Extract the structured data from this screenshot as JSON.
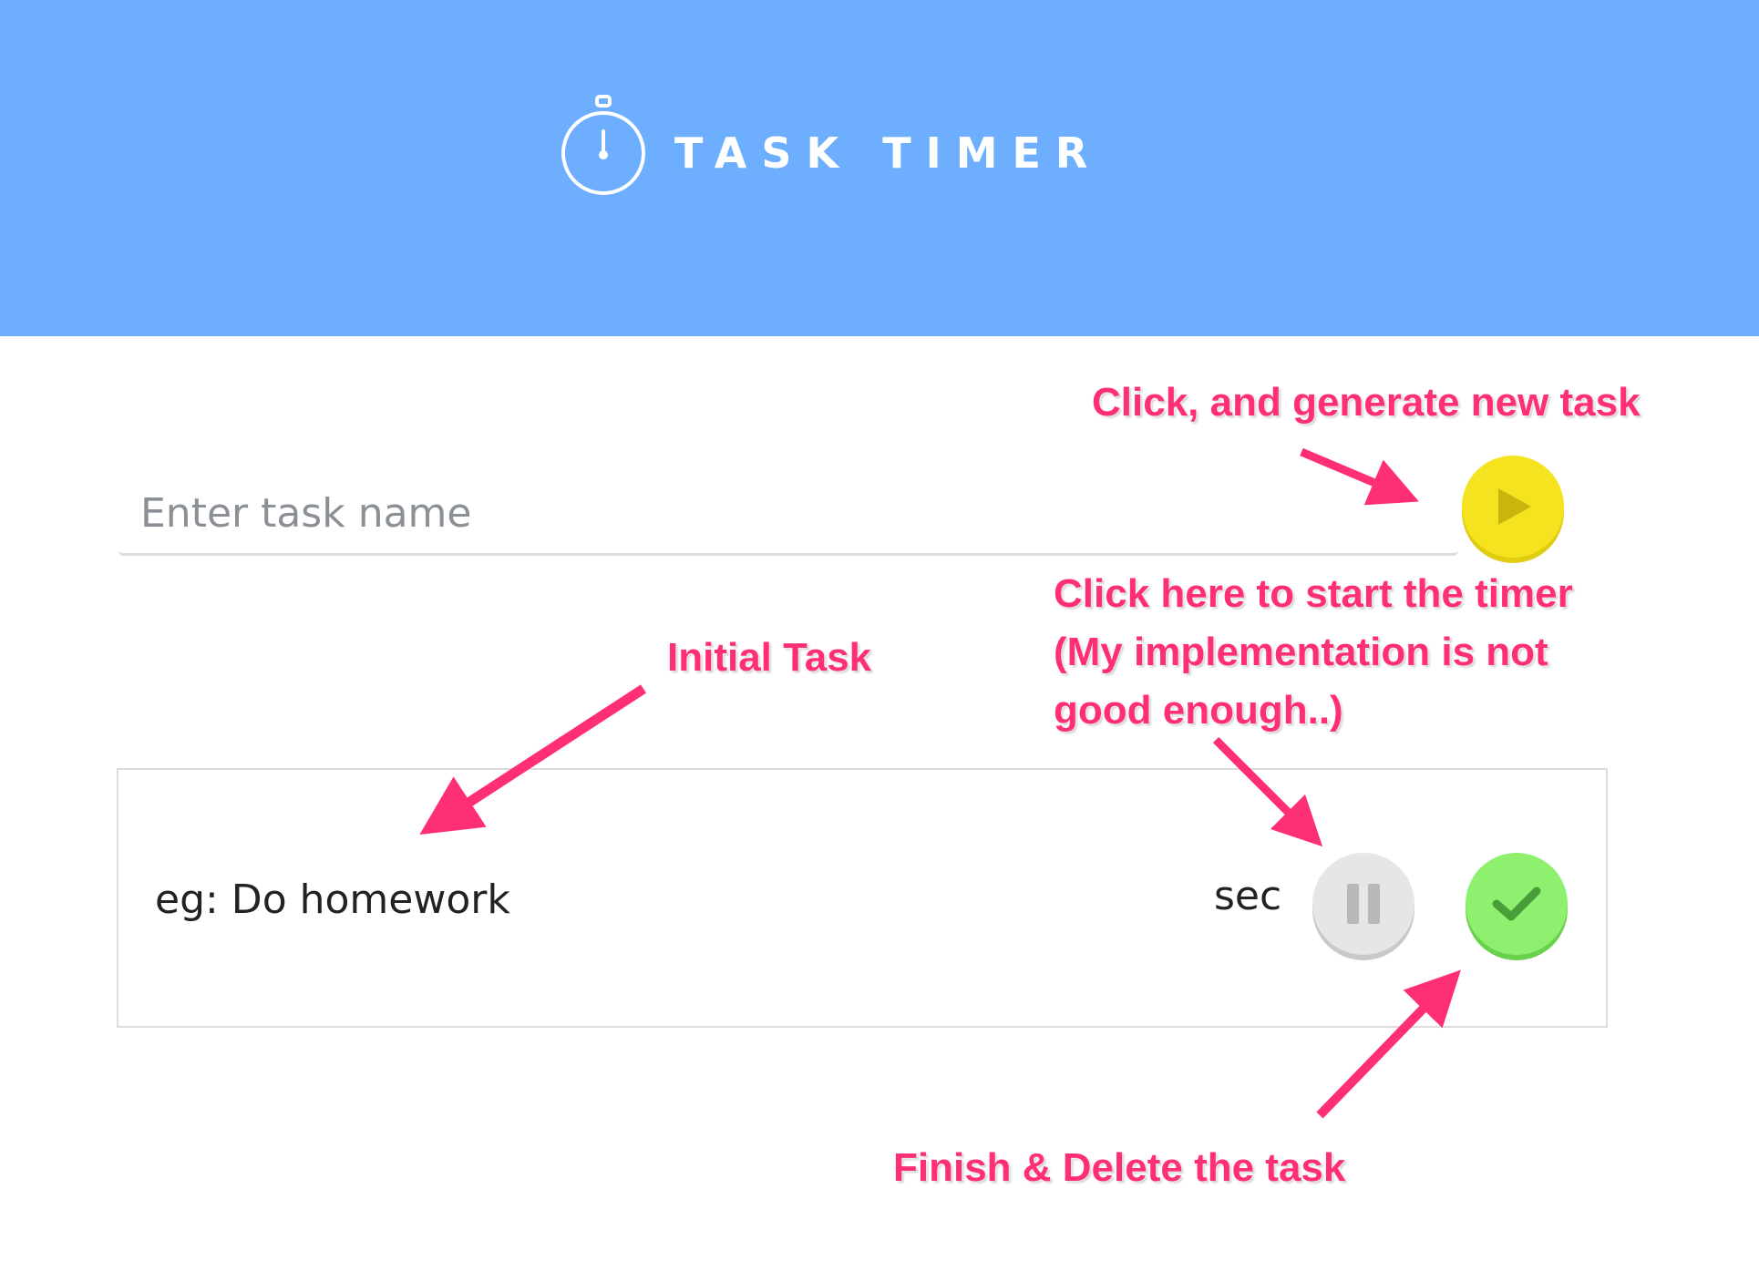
{
  "header": {
    "title": "TASK TIMER",
    "background_color": "#6daeff",
    "logo_icon": "stopwatch-icon"
  },
  "task_form": {
    "input_placeholder": "Enter task name",
    "input_value": "",
    "add_button_icon": "play-icon",
    "add_button_color": "#f5e31f"
  },
  "tasks": [
    {
      "name": "eg: Do homework",
      "unit": "sec",
      "pause_button_icon": "pause-icon",
      "done_button_icon": "check-icon",
      "done_button_color": "#8ff070"
    }
  ],
  "annotations": {
    "color": "#ff2f73",
    "generate": "Click, and generate new task",
    "timer_line1": "Click here to start the timer",
    "timer_line2": "(My implementation is not",
    "timer_line3": "good enough..)",
    "initial": "Initial Task",
    "finish": "Finish & Delete the task"
  }
}
